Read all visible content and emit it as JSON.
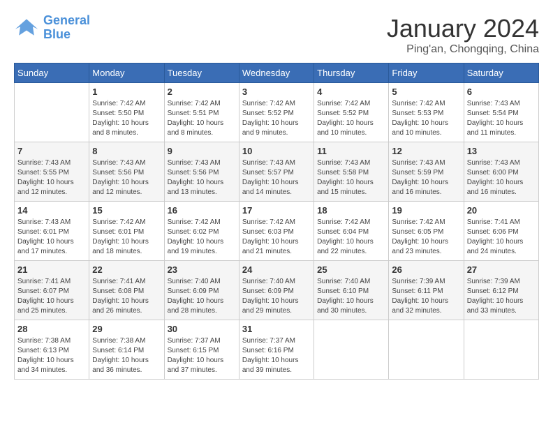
{
  "logo": {
    "line1": "General",
    "line2": "Blue"
  },
  "title": "January 2024",
  "subtitle": "Ping'an, Chongqing, China",
  "weekdays": [
    "Sunday",
    "Monday",
    "Tuesday",
    "Wednesday",
    "Thursday",
    "Friday",
    "Saturday"
  ],
  "weeks": [
    [
      {
        "day": null,
        "info": null
      },
      {
        "day": "1",
        "info": "Sunrise: 7:42 AM\nSunset: 5:50 PM\nDaylight: 10 hours\nand 8 minutes."
      },
      {
        "day": "2",
        "info": "Sunrise: 7:42 AM\nSunset: 5:51 PM\nDaylight: 10 hours\nand 8 minutes."
      },
      {
        "day": "3",
        "info": "Sunrise: 7:42 AM\nSunset: 5:52 PM\nDaylight: 10 hours\nand 9 minutes."
      },
      {
        "day": "4",
        "info": "Sunrise: 7:42 AM\nSunset: 5:52 PM\nDaylight: 10 hours\nand 10 minutes."
      },
      {
        "day": "5",
        "info": "Sunrise: 7:42 AM\nSunset: 5:53 PM\nDaylight: 10 hours\nand 10 minutes."
      },
      {
        "day": "6",
        "info": "Sunrise: 7:43 AM\nSunset: 5:54 PM\nDaylight: 10 hours\nand 11 minutes."
      }
    ],
    [
      {
        "day": "7",
        "info": "Sunrise: 7:43 AM\nSunset: 5:55 PM\nDaylight: 10 hours\nand 12 minutes."
      },
      {
        "day": "8",
        "info": "Sunrise: 7:43 AM\nSunset: 5:56 PM\nDaylight: 10 hours\nand 12 minutes."
      },
      {
        "day": "9",
        "info": "Sunrise: 7:43 AM\nSunset: 5:56 PM\nDaylight: 10 hours\nand 13 minutes."
      },
      {
        "day": "10",
        "info": "Sunrise: 7:43 AM\nSunset: 5:57 PM\nDaylight: 10 hours\nand 14 minutes."
      },
      {
        "day": "11",
        "info": "Sunrise: 7:43 AM\nSunset: 5:58 PM\nDaylight: 10 hours\nand 15 minutes."
      },
      {
        "day": "12",
        "info": "Sunrise: 7:43 AM\nSunset: 5:59 PM\nDaylight: 10 hours\nand 16 minutes."
      },
      {
        "day": "13",
        "info": "Sunrise: 7:43 AM\nSunset: 6:00 PM\nDaylight: 10 hours\nand 16 minutes."
      }
    ],
    [
      {
        "day": "14",
        "info": "Sunrise: 7:43 AM\nSunset: 6:01 PM\nDaylight: 10 hours\nand 17 minutes."
      },
      {
        "day": "15",
        "info": "Sunrise: 7:42 AM\nSunset: 6:01 PM\nDaylight: 10 hours\nand 18 minutes."
      },
      {
        "day": "16",
        "info": "Sunrise: 7:42 AM\nSunset: 6:02 PM\nDaylight: 10 hours\nand 19 minutes."
      },
      {
        "day": "17",
        "info": "Sunrise: 7:42 AM\nSunset: 6:03 PM\nDaylight: 10 hours\nand 21 minutes."
      },
      {
        "day": "18",
        "info": "Sunrise: 7:42 AM\nSunset: 6:04 PM\nDaylight: 10 hours\nand 22 minutes."
      },
      {
        "day": "19",
        "info": "Sunrise: 7:42 AM\nSunset: 6:05 PM\nDaylight: 10 hours\nand 23 minutes."
      },
      {
        "day": "20",
        "info": "Sunrise: 7:41 AM\nSunset: 6:06 PM\nDaylight: 10 hours\nand 24 minutes."
      }
    ],
    [
      {
        "day": "21",
        "info": "Sunrise: 7:41 AM\nSunset: 6:07 PM\nDaylight: 10 hours\nand 25 minutes."
      },
      {
        "day": "22",
        "info": "Sunrise: 7:41 AM\nSunset: 6:08 PM\nDaylight: 10 hours\nand 26 minutes."
      },
      {
        "day": "23",
        "info": "Sunrise: 7:40 AM\nSunset: 6:09 PM\nDaylight: 10 hours\nand 28 minutes."
      },
      {
        "day": "24",
        "info": "Sunrise: 7:40 AM\nSunset: 6:09 PM\nDaylight: 10 hours\nand 29 minutes."
      },
      {
        "day": "25",
        "info": "Sunrise: 7:40 AM\nSunset: 6:10 PM\nDaylight: 10 hours\nand 30 minutes."
      },
      {
        "day": "26",
        "info": "Sunrise: 7:39 AM\nSunset: 6:11 PM\nDaylight: 10 hours\nand 32 minutes."
      },
      {
        "day": "27",
        "info": "Sunrise: 7:39 AM\nSunset: 6:12 PM\nDaylight: 10 hours\nand 33 minutes."
      }
    ],
    [
      {
        "day": "28",
        "info": "Sunrise: 7:38 AM\nSunset: 6:13 PM\nDaylight: 10 hours\nand 34 minutes."
      },
      {
        "day": "29",
        "info": "Sunrise: 7:38 AM\nSunset: 6:14 PM\nDaylight: 10 hours\nand 36 minutes."
      },
      {
        "day": "30",
        "info": "Sunrise: 7:37 AM\nSunset: 6:15 PM\nDaylight: 10 hours\nand 37 minutes."
      },
      {
        "day": "31",
        "info": "Sunrise: 7:37 AM\nSunset: 6:16 PM\nDaylight: 10 hours\nand 39 minutes."
      },
      {
        "day": null,
        "info": null
      },
      {
        "day": null,
        "info": null
      },
      {
        "day": null,
        "info": null
      }
    ]
  ]
}
